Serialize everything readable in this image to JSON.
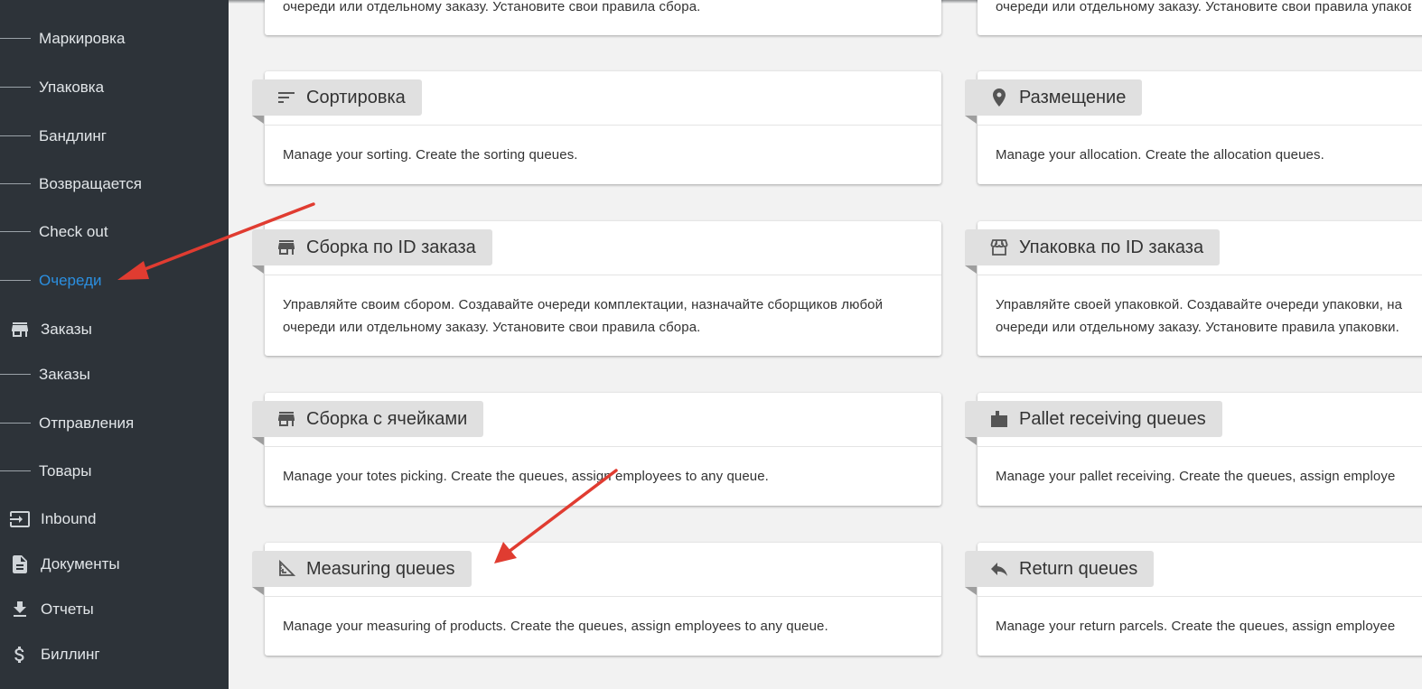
{
  "sidebar": {
    "items": [
      {
        "label": "Маркировка"
      },
      {
        "label": "Упаковка"
      },
      {
        "label": "Бандлинг"
      },
      {
        "label": "Возвращается"
      },
      {
        "label": "Check out"
      },
      {
        "label": "Очереди",
        "active": true
      },
      {
        "label": "Заказы",
        "icon": "store-icon"
      },
      {
        "label": "Заказы"
      },
      {
        "label": "Отправления"
      },
      {
        "label": "Товары"
      },
      {
        "label": "Inbound",
        "icon": "login-icon"
      },
      {
        "label": "Документы",
        "icon": "document-icon"
      },
      {
        "label": "Отчеты",
        "icon": "download-icon"
      },
      {
        "label": "Биллинг",
        "icon": "dollar-icon"
      }
    ]
  },
  "cards": {
    "top_left": {
      "desc": "очереди или отдельному заказу. Установите свои правила сбора."
    },
    "top_right": {
      "desc": "очереди или отдельному заказу. Установите свои правила упаковки."
    },
    "sorting": {
      "title": "Сортировка",
      "icon": "sort-icon",
      "desc": "Manage your sorting. Create the sorting queues."
    },
    "allocation": {
      "title": "Размещение",
      "icon": "location-pin-icon",
      "desc": "Manage your allocation. Create the allocation queues."
    },
    "picking_by_order": {
      "title": "Сборка по ID заказа",
      "icon": "store-icon",
      "desc1": "Управляйте своим сбором. Создавайте очереди комплектации, назначайте сборщиков любой",
      "desc2": "очереди или отдельному заказу. Установите свои правила сбора."
    },
    "packing_by_order": {
      "title": "Упаковка по ID заказа",
      "icon": "storefront-icon",
      "desc1": "Управляйте своей упаковкой. Создавайте очереди упаковки, на",
      "desc2": "очереди или отдельному заказу. Установите правила упаковки."
    },
    "totes_picking": {
      "title": "Сборка с ячейками",
      "icon": "store-icon",
      "desc": "Manage your totes picking. Create the queues, assign employees to any queue."
    },
    "pallet_receiving": {
      "title": "Pallet receiving queues",
      "icon": "pallet-box-icon",
      "desc": "Manage your pallet receiving. Create the queues, assign employe"
    },
    "measuring": {
      "title": "Measuring queues",
      "icon": "square-foot-icon",
      "desc": "Manage your measuring of products. Create the queues, assign employees to any queue."
    },
    "returns": {
      "title": "Return queues",
      "icon": "reply-icon",
      "desc": "Manage your return parcels. Create the queues, assign employee"
    }
  },
  "colors": {
    "sidebar_bg": "#2d3339",
    "active": "#2b8fe0",
    "arrow": "#e03c31"
  }
}
